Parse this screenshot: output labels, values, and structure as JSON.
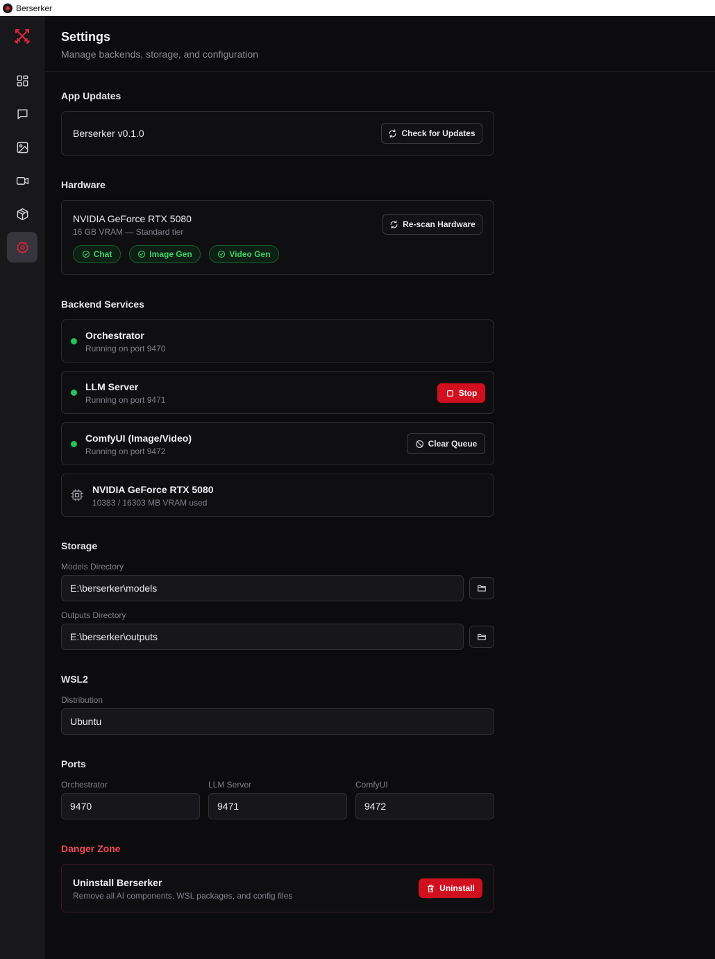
{
  "window": {
    "title": "Berserker"
  },
  "sidebar": {
    "items": [
      {
        "name": "dashboard",
        "icon": "grid-icon"
      },
      {
        "name": "chat",
        "icon": "chat-icon"
      },
      {
        "name": "image",
        "icon": "image-icon"
      },
      {
        "name": "video",
        "icon": "video-icon"
      },
      {
        "name": "models",
        "icon": "box-icon"
      },
      {
        "name": "settings",
        "icon": "gear-icon",
        "active": true
      }
    ]
  },
  "header": {
    "title": "Settings",
    "subtitle": "Manage backends, storage, and configuration"
  },
  "app_updates": {
    "section_title": "App Updates",
    "version_label": "Berserker v0.1.0",
    "check_button": "Check for Updates"
  },
  "hardware": {
    "section_title": "Hardware",
    "gpu_name": "NVIDIA GeForce RTX 5080",
    "gpu_detail": "16 GB VRAM — Standard tier",
    "rescan_button": "Re-scan Hardware",
    "capabilities": [
      "Chat",
      "Image Gen",
      "Video Gen"
    ]
  },
  "backend_services": {
    "section_title": "Backend Services",
    "orchestrator": {
      "name": "Orchestrator",
      "status": "Running on port 9470"
    },
    "llm_server": {
      "name": "LLM Server",
      "status": "Running on port 9471",
      "action": "Stop"
    },
    "comfyui": {
      "name": "ComfyUI (Image/Video)",
      "status": "Running on port 9472",
      "action": "Clear Queue"
    },
    "gpu": {
      "name": "NVIDIA GeForce RTX 5080",
      "usage": "10383 / 16303 MB VRAM used"
    }
  },
  "storage": {
    "section_title": "Storage",
    "models_label": "Models Directory",
    "models_value": "E:\\berserker\\models",
    "outputs_label": "Outputs Directory",
    "outputs_value": "E:\\berserker\\outputs"
  },
  "wsl2": {
    "section_title": "WSL2",
    "distribution_label": "Distribution",
    "distribution_value": "Ubuntu"
  },
  "ports": {
    "section_title": "Ports",
    "orchestrator_label": "Orchestrator",
    "orchestrator_value": "9470",
    "llm_label": "LLM Server",
    "llm_value": "9471",
    "comfyui_label": "ComfyUI",
    "comfyui_value": "9472"
  },
  "danger_zone": {
    "section_title": "Danger Zone",
    "title": "Uninstall Berserker",
    "description": "Remove all AI components, WSL packages, and config files",
    "button": "Uninstall"
  },
  "colors": {
    "accent_red": "#d0101f",
    "status_green": "#22c55e",
    "background": "#0c0c0e",
    "sidebar": "#18181b"
  }
}
